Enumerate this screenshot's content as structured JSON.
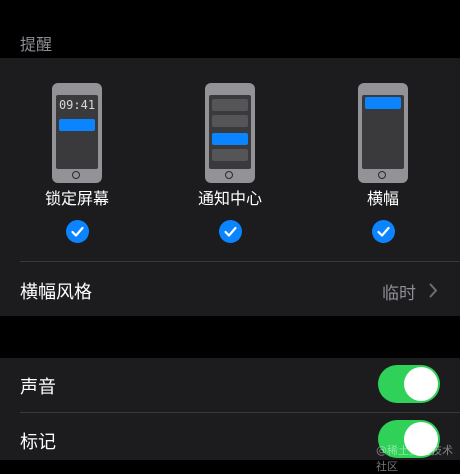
{
  "section": {
    "title": "提醒"
  },
  "alert_styles": [
    {
      "label": "锁定屏幕",
      "preview_time": "09:41",
      "checked": true
    },
    {
      "label": "通知中心",
      "checked": true
    },
    {
      "label": "横幅",
      "checked": true
    }
  ],
  "banner_style": {
    "label": "横幅风格",
    "value": "临时",
    "icon": "chevron-right-icon"
  },
  "sounds": {
    "label": "声音",
    "enabled": true
  },
  "badges": {
    "label": "标记",
    "enabled": true
  },
  "watermark": {
    "text": "@稀土掘金技术社区"
  },
  "colors": {
    "accent": "#0a84ff",
    "toggle_on": "#30d158",
    "group_bg": "#1c1c1e",
    "page_bg": "#000000",
    "secondary_text": "#8d8d93"
  }
}
